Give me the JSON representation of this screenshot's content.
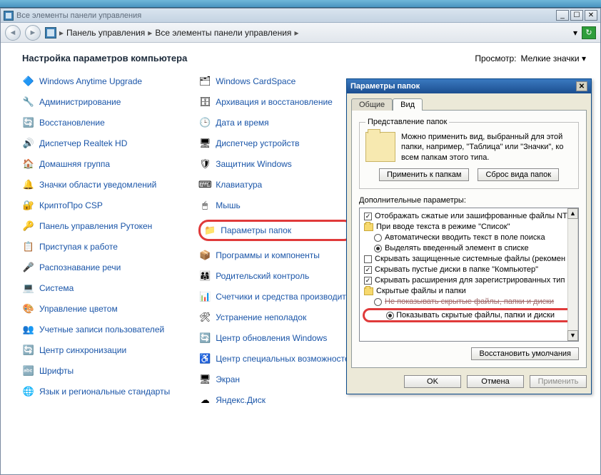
{
  "mainWindow": {
    "title": "Все элементы панели управления",
    "min": "_",
    "max": "☐",
    "close": "✕",
    "back": "◄",
    "fwd": "►",
    "crumb1": "Панель управления",
    "crumb2": "Все элементы панели управления",
    "dropdownGlyph": "▾",
    "refresh": "↻"
  },
  "header": {
    "title": "Настройка параметров компьютера",
    "viewLabel": "Просмотр:",
    "viewValue": "Мелкие значки"
  },
  "col1": {
    "i0": {
      "icon": "🔷",
      "label": "Windows Anytime Upgrade"
    },
    "i1": {
      "icon": "🔧",
      "label": "Администрирование"
    },
    "i2": {
      "icon": "🔄",
      "label": "Восстановление"
    },
    "i3": {
      "icon": "🔊",
      "label": "Диспетчер Realtek HD"
    },
    "i4": {
      "icon": "🏠",
      "label": "Домашняя группа"
    },
    "i5": {
      "icon": "🔔",
      "label": "Значки области уведомлений"
    },
    "i6": {
      "icon": "🔐",
      "label": "КриптоПро CSP"
    },
    "i7": {
      "icon": "🔑",
      "label": "Панель управления Рутокен"
    },
    "i8": {
      "icon": "📋",
      "label": "Приступая к работе"
    },
    "i9": {
      "icon": "🎤",
      "label": "Распознавание речи"
    },
    "i10": {
      "icon": "💻",
      "label": "Система"
    },
    "i11": {
      "icon": "🎨",
      "label": "Управление цветом"
    },
    "i12": {
      "icon": "👥",
      "label": "Учетные записи пользователей"
    },
    "i13": {
      "icon": "🔄",
      "label": "Центр синхронизации"
    },
    "i14": {
      "icon": "🔤",
      "label": "Шрифты"
    },
    "i15": {
      "icon": "🌐",
      "label": "Язык и региональные стандарты"
    }
  },
  "col2": {
    "i0": {
      "icon": "🗂",
      "label": "Windows CardSpace"
    },
    "i1": {
      "icon": "🗄",
      "label": "Архивация и восстановление"
    },
    "i2": {
      "icon": "🕒",
      "label": "Дата и время"
    },
    "i3": {
      "icon": "🖥",
      "label": "Диспетчер устройств"
    },
    "i4": {
      "icon": "🛡",
      "label": "Защитник Windows"
    },
    "i5": {
      "icon": "⌨",
      "label": "Клавиатура"
    },
    "i6": {
      "icon": "🖱",
      "label": "Мышь"
    },
    "i7": {
      "icon": "📁",
      "label": "Параметры папок"
    },
    "i8": {
      "icon": "📦",
      "label": "Программы и компоненты"
    },
    "i9": {
      "icon": "👨‍👩‍👧",
      "label": "Родительский контроль"
    },
    "i10": {
      "icon": "📊",
      "label": "Счетчики и средства производите"
    },
    "i11": {
      "icon": "🛠",
      "label": "Устранение неполадок"
    },
    "i12": {
      "icon": "🔄",
      "label": "Центр обновления Windows"
    },
    "i13": {
      "icon": "♿",
      "label": "Центр специальных возможностей"
    },
    "i14": {
      "icon": "🖥",
      "label": "Экран"
    },
    "i15": {
      "icon": "☁",
      "label": "Яндекс.Диск"
    }
  },
  "dialog": {
    "title": "Параметры папок",
    "tab1": "Общие",
    "tab2": "Вид",
    "groupTitle": "Представление папок",
    "groupText": "Можно применить вид, выбранный для этой папки, например, \"Таблица\" или \"Значки\", ко всем папкам этого типа.",
    "applyFolders": "Применить к папкам",
    "resetFolders": "Сброс вида папок",
    "advLabel": "Дополнительные параметры:",
    "tree": {
      "r0": "Отображать сжатые или зашифрованные файлы NT",
      "r1": "При вводе текста в режиме \"Список\"",
      "r2": "Автоматически вводить текст в поле поиска",
      "r3": "Выделять введенный элемент в списке",
      "r4": "Скрывать защищенные системные файлы (рекомен",
      "r5": "Скрывать пустые диски в папке \"Компьютер\"",
      "r6": "Скрывать расширения для зарегистрированных тип",
      "r7": "Скрытые файлы и папки",
      "r8": "Не показывать скрытые файлы, папки и диски",
      "r9": "Показывать скрытые файлы, папки и диски"
    },
    "restore": "Восстановить умолчания",
    "ok": "OK",
    "cancel": "Отмена",
    "apply": "Применить",
    "close": "✕"
  }
}
